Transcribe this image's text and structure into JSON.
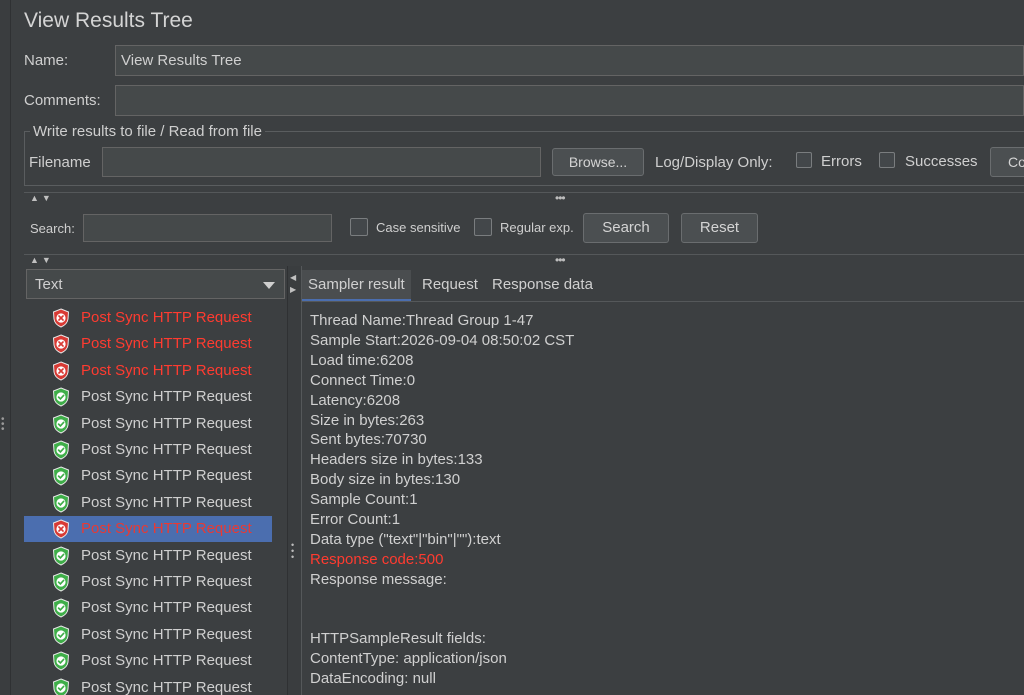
{
  "window": {
    "title": "View Results Tree"
  },
  "name_field": {
    "label": "Name:",
    "value": "View Results Tree"
  },
  "comments_field": {
    "label": "Comments:",
    "value": ""
  },
  "file_section": {
    "legend": "Write results to file / Read from file",
    "filename_label": "Filename",
    "filename_value": "",
    "browse_label": "Browse...",
    "log_display_label": "Log/Display Only:",
    "errors_label": "Errors",
    "successes_label": "Successes",
    "configure_label": "Co"
  },
  "search": {
    "label": "Search:",
    "value": "",
    "case_sensitive_label": "Case sensitive",
    "regex_label": "Regular exp.",
    "search_button": "Search",
    "reset_button": "Reset"
  },
  "renderer": {
    "selected": "Text"
  },
  "tree": {
    "items": [
      {
        "label": "Post Sync HTTP Request",
        "status": "error"
      },
      {
        "label": "Post Sync HTTP Request",
        "status": "error"
      },
      {
        "label": "Post Sync HTTP Request",
        "status": "error"
      },
      {
        "label": "Post Sync HTTP Request",
        "status": "ok"
      },
      {
        "label": "Post Sync HTTP Request",
        "status": "ok"
      },
      {
        "label": "Post Sync HTTP Request",
        "status": "ok"
      },
      {
        "label": "Post Sync HTTP Request",
        "status": "ok"
      },
      {
        "label": "Post Sync HTTP Request",
        "status": "ok"
      },
      {
        "label": "Post Sync HTTP Request",
        "status": "error",
        "selected": true
      },
      {
        "label": "Post Sync HTTP Request",
        "status": "ok"
      },
      {
        "label": "Post Sync HTTP Request",
        "status": "ok"
      },
      {
        "label": "Post Sync HTTP Request",
        "status": "ok"
      },
      {
        "label": "Post Sync HTTP Request",
        "status": "ok"
      },
      {
        "label": "Post Sync HTTP Request",
        "status": "ok"
      },
      {
        "label": "Post Sync HTTP Request",
        "status": "ok"
      }
    ]
  },
  "tabs": [
    {
      "label": "Sampler result",
      "active": true
    },
    {
      "label": "Request",
      "active": false
    },
    {
      "label": "Response data",
      "active": false
    }
  ],
  "sampler_result": {
    "lines": [
      {
        "text": "Thread Name:Thread Group 1-47"
      },
      {
        "text": "Sample Start:2026-09-04 08:50:02 CST"
      },
      {
        "text": "Load time:6208"
      },
      {
        "text": "Connect Time:0"
      },
      {
        "text": "Latency:6208"
      },
      {
        "text": "Size in bytes:263"
      },
      {
        "text": "Sent bytes:70730"
      },
      {
        "text": "Headers size in bytes:133"
      },
      {
        "text": "Body size in bytes:130"
      },
      {
        "text": "Sample Count:1"
      },
      {
        "text": "Error Count:1"
      },
      {
        "text": "Data type (\"text\"|\"bin\"|\"\"):text"
      },
      {
        "text": "Response code:500",
        "highlight": "error"
      },
      {
        "text": "Response message:"
      },
      {
        "text": ""
      },
      {
        "text": ""
      },
      {
        "text": "HTTPSampleResult fields:"
      },
      {
        "text": "ContentType: application/json"
      },
      {
        "text": "DataEncoding: null"
      }
    ]
  },
  "colors": {
    "background": "#3c3f41",
    "selection": "#4b6eaf",
    "error_text": "#ff3b30",
    "success_shield": "#3fae49",
    "error_shield": "#d83a34"
  }
}
